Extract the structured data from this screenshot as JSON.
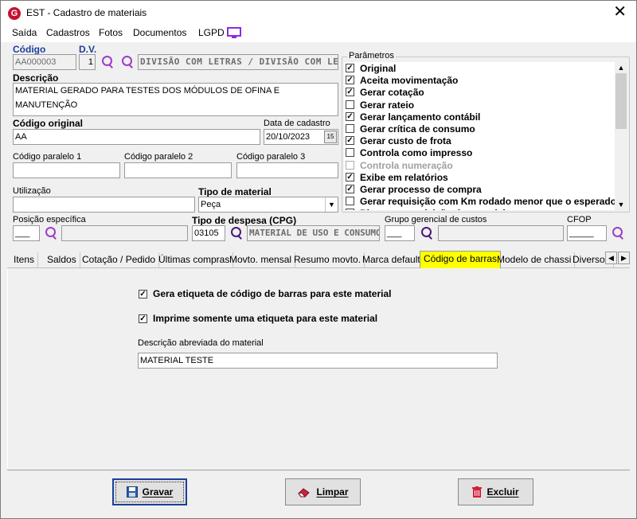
{
  "window": {
    "title": "EST - Cadastro de materiais",
    "logo_letter": "G",
    "close": "✕"
  },
  "menu": [
    "Saída",
    "Cadastros",
    "Fotos",
    "Documentos",
    "LGPD"
  ],
  "form": {
    "codigo_label": "Código",
    "codigo_value": "AA000003",
    "dv_label": "D.V.",
    "dv_value": "1",
    "divisao_value": "DIVISÃO COM LETRAS / DIVISÃO COM LETRAS",
    "descricao_label": "Descrição",
    "descricao_value": "MATERIAL GERADO PARA TESTES DOS MÓDULOS DE OFINA E MANUTENÇÃO",
    "codigo_original_label": "Código original",
    "codigo_original_value": "AA",
    "data_cadastro_label": "Data de cadastro",
    "data_cadastro_value": "20/10/2023",
    "calendar_icon_text": "15",
    "cp1_label": "Código paralelo 1",
    "cp2_label": "Código paralelo 2",
    "cp3_label": "Código paralelo 3",
    "utilizacao_label": "Utilização",
    "tipo_material_label": "Tipo de material",
    "tipo_material_value": "Peça",
    "posicao_label": "Posição específica",
    "posicao_value": "___",
    "tipo_despesa_label": "Tipo de despesa (CPG)",
    "tipo_despesa_code": "03105",
    "tipo_despesa_desc": "MATERIAL DE USO E CONSUMO",
    "grupo_label": "Grupo gerencial de custos",
    "grupo_value": "___",
    "cfop_label": "CFOP",
    "cfop_value": "_____"
  },
  "params": {
    "title": "Parâmetros",
    "items": [
      {
        "label": "Original",
        "checked": true
      },
      {
        "label": "Aceita movimentação",
        "checked": true
      },
      {
        "label": "Gerar cotação",
        "checked": true
      },
      {
        "label": "Gerar rateio",
        "checked": false
      },
      {
        "label": "Gerar lançamento contábil",
        "checked": true
      },
      {
        "label": "Gerar crítica de consumo",
        "checked": false
      },
      {
        "label": "Gerar custo de frota",
        "checked": true
      },
      {
        "label": "Controla como impresso",
        "checked": false
      },
      {
        "label": "Controla numeração",
        "checked": false,
        "disabled": true
      },
      {
        "label": "Exibe em relatórios",
        "checked": true
      },
      {
        "label": "Gerar processo de compra",
        "checked": true
      },
      {
        "label": "Gerar requisição com Km rodado menor que o esperado",
        "checked": false
      },
      {
        "label": "Bloquear requisição do material",
        "checked": false
      }
    ]
  },
  "tabs": [
    "Itens",
    "Saldos",
    "Cotação / Pedido",
    "Últimas compras",
    "Movto. mensal",
    "Resumo movto.",
    "Marca default",
    "Código de barras",
    "Modelo de chassi",
    "Diversos"
  ],
  "active_tab": "Código de barras",
  "barcode": {
    "gera_etiqueta_label": "Gera etiqueta de código de barras para este material",
    "gera_etiqueta_checked": true,
    "imprime_label": "Imprime somente uma etiqueta para este material",
    "imprime_checked": true,
    "descricao_abreviada_label": "Descrição abreviada do material",
    "descricao_abreviada_value": "MATERIAL TESTE"
  },
  "buttons": {
    "gravar": "Gravar",
    "limpar": "Limpar",
    "excluir": "Excluir"
  },
  "colors": {
    "active_tab": "#ffff00",
    "accent_blue": "#1a3f9b",
    "search_icon": "#9a3fc8"
  }
}
